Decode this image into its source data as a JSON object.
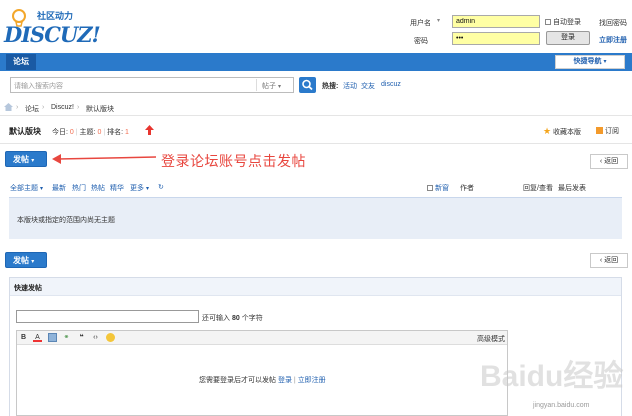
{
  "header": {
    "logo_text": "DISCUZ!",
    "logo_sub": "社区动力",
    "username_label": "用户名",
    "username_value": "admin",
    "password_label": "密码",
    "password_value": "•••",
    "auto_login": "自动登录",
    "find_password": "找回密码",
    "login_button": "登录",
    "register": "立即注册"
  },
  "nav": {
    "forum_tab": "论坛",
    "quick_nav": "快捷导航"
  },
  "search": {
    "placeholder": "请输入搜索内容",
    "type": "帖子",
    "hot_label": "热搜:",
    "hot_links": [
      "活动",
      "交友",
      "discuz"
    ]
  },
  "breadcrumb": [
    "论坛",
    "Discuz!",
    "默认版块"
  ],
  "forum": {
    "name": "默认版块",
    "today_label": "今日:",
    "today_value": "0",
    "topics_label": "主题:",
    "topics_value": "0",
    "rank_label": "排名:",
    "rank_value": "1",
    "favorite": "收藏本版",
    "subscribe": "订阅"
  },
  "post_button": "发帖",
  "back_button": "返回",
  "annotation": "登录论坛账号点击发帖",
  "thread_list": {
    "filters": [
      "全部主题",
      "最新",
      "热门",
      "热帖",
      "精华",
      "更多"
    ],
    "new_window": "新窗",
    "author": "作者",
    "replies_views": "回复/查看",
    "last_post": "最后发表",
    "empty_message": "本版块或指定的范围内尚无主题"
  },
  "quick_post": {
    "title": "快速发帖",
    "hint_prefix": "还可输入",
    "hint_count": "80",
    "hint_suffix": "个字符",
    "advanced_mode": "高级模式",
    "toolbar_icons": [
      "bold-icon",
      "font-color-icon",
      "image-icon",
      "link-icon",
      "quote-icon",
      "code-icon",
      "smiley-icon"
    ],
    "login_notice": "您需要登录后才可以发帖",
    "login_link": "登录",
    "separator": "|",
    "register_link": "立即注册"
  },
  "watermark": {
    "text": "Baidu经验",
    "site": "jingyan.baidu.com"
  }
}
